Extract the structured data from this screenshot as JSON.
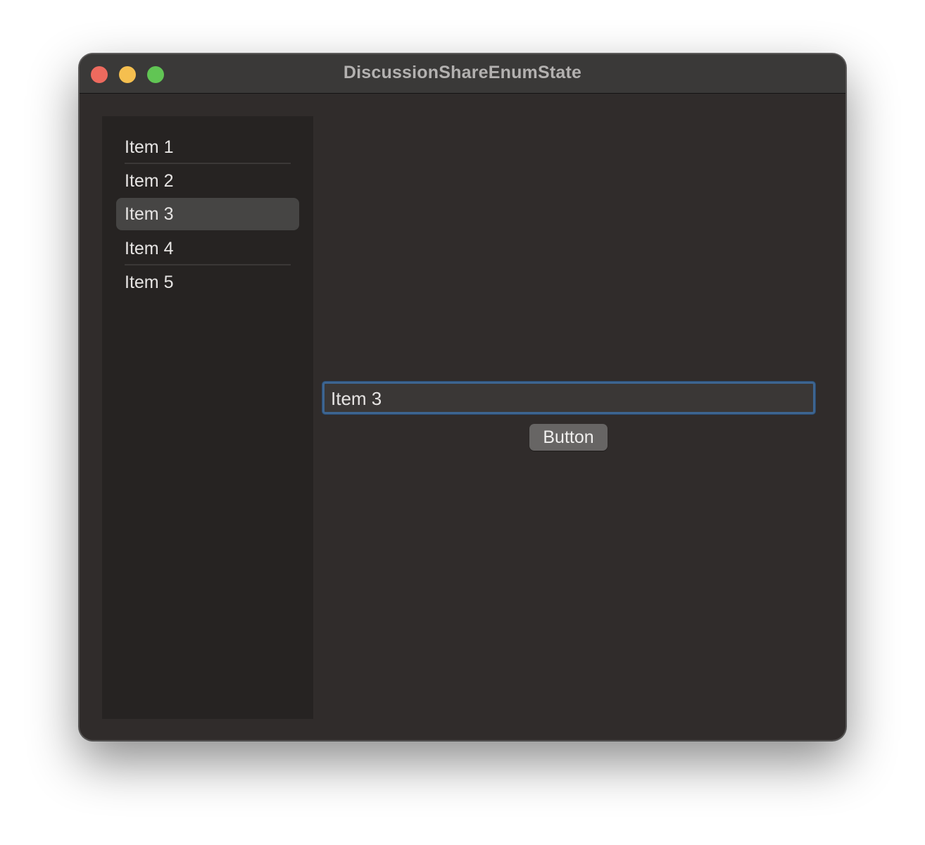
{
  "window": {
    "title": "DiscussionShareEnumState"
  },
  "sidebar": {
    "items": [
      {
        "label": "Item 1",
        "selected": false
      },
      {
        "label": "Item 2",
        "selected": false
      },
      {
        "label": "Item 3",
        "selected": true
      },
      {
        "label": "Item 4",
        "selected": false
      },
      {
        "label": "Item 5",
        "selected": false
      }
    ]
  },
  "detail": {
    "text_field_value": "Item 3",
    "button_label": "Button"
  },
  "colors": {
    "window_background": "#302c2b",
    "sidebar_background": "#262322",
    "selection_background": "#464544",
    "focus_ring": "#3d6591",
    "close": "#ed6a5e",
    "minimize": "#f5bf4f",
    "zoom": "#61c554"
  }
}
